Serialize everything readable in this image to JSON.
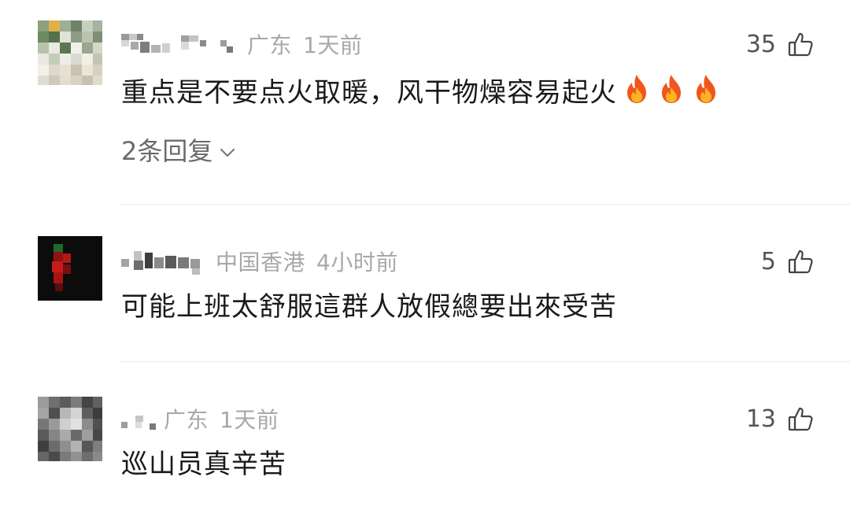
{
  "comments": [
    {
      "location": "广东",
      "time": "1天前",
      "likes": "35",
      "text": "重点是不要点火取暖，风干物燥容易起火",
      "emojis": [
        "fire-emoji",
        "fire-emoji",
        "fire-emoji"
      ],
      "replies_label": "2条回复"
    },
    {
      "location": "中国香港",
      "time": "4小时前",
      "likes": "5",
      "text": "可能上班太舒服這群人放假總要出來受苦"
    },
    {
      "location": "广东",
      "time": "1天前",
      "likes": "13",
      "text": "巡山员真辛苦"
    }
  ],
  "icons": {
    "like": "thumbs-up-icon",
    "expand": "chevron-down-icon"
  },
  "colors": {
    "meta_gray": "#a8a8a8",
    "text": "#1a1a1a",
    "divider": "#e8e8e8"
  }
}
